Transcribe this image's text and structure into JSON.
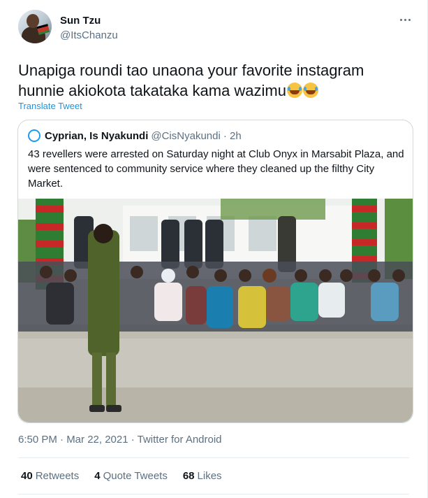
{
  "author": {
    "name": "Sun Tzu",
    "handle": "@ItsChanzu"
  },
  "tweet": {
    "text": "Unapiga roundi tao unaona your favorite instagram hunnie akiokota takataka kama wazimu",
    "translate_label": "Translate Tweet"
  },
  "quoted": {
    "name": "Cyprian, Is Nyakundi",
    "handle": "@CisNyakundi",
    "time": "· 2h",
    "text": "43 revellers were arrested on Saturday night at Club Onyx in Marsabit Plaza, and were sentenced to community service where they cleaned up the filthy City Market."
  },
  "meta": "6:50 PM · Mar 22, 2021 · Twitter for Android",
  "stats": {
    "retweets_count": "40",
    "retweets_label": "Retweets",
    "quotes_count": "4",
    "quotes_label": "Quote Tweets",
    "likes_count": "68",
    "likes_label": "Likes"
  },
  "colors": {
    "link": "#1b95e0",
    "muted": "#5b7083",
    "border": "#cfd9de"
  }
}
